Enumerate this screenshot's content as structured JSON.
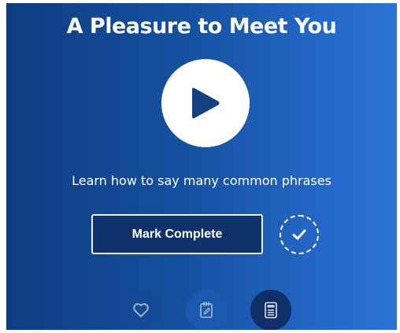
{
  "lesson": {
    "title": "A Pleasure to Meet You",
    "description": "Learn how to say many common phrases"
  },
  "actions": {
    "play_icon": "play-icon",
    "mark_complete_label": "Mark Complete",
    "check_icon": "checkmark-icon",
    "favorite_icon": "heart-icon",
    "notes_icon": "notepad-pencil-icon",
    "pdf_icon": "pdf-document-icon"
  },
  "colors": {
    "background_dark": "#0f3d82",
    "background_light": "#2b74d4",
    "play_button": "#ffffff",
    "play_triangle": "#16407f",
    "mark_button": "#0f326b"
  }
}
